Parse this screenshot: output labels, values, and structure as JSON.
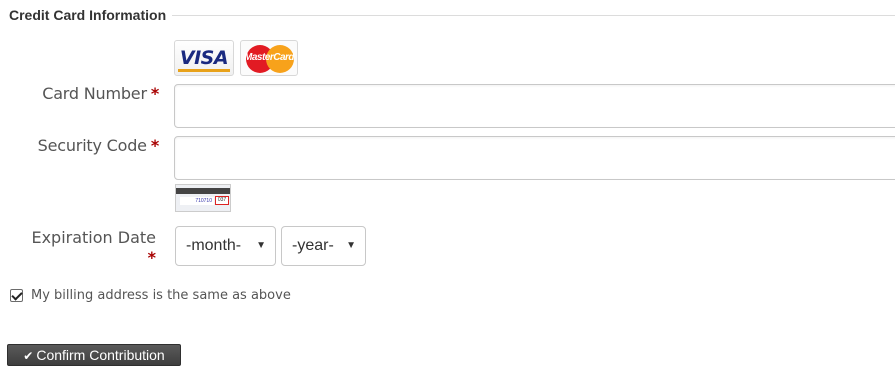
{
  "section": {
    "title": "Credit Card Information"
  },
  "card_logos": {
    "visa": "VISA",
    "mastercard": "MasterCard"
  },
  "fields": {
    "card_number": {
      "label": "Card Number",
      "required_mark": "*",
      "value": ""
    },
    "security_code": {
      "label": "Security Code",
      "required_mark": "*",
      "value": ""
    },
    "expiration": {
      "label": "Expiration Date",
      "required_mark": "*",
      "month": "-month-",
      "year": "-year-"
    }
  },
  "cvv_hint": {
    "digits": "710710",
    "code": "037"
  },
  "billing_checkbox": {
    "checked": true,
    "label": "My billing address is the same as above"
  },
  "confirm_button": {
    "icon": "check-icon",
    "label": "Confirm Contribution"
  }
}
